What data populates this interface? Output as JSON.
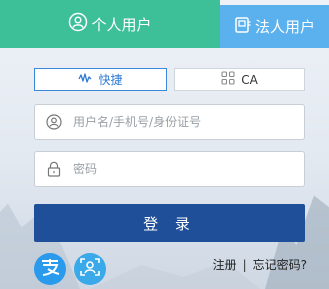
{
  "tabs": {
    "personal_label": "个人用户",
    "legal_label": "法人用户"
  },
  "modes": {
    "quick_label": "快捷",
    "ca_label": "CA"
  },
  "fields": {
    "username_placeholder": "用户名/手机号/身份证号",
    "password_placeholder": "密码"
  },
  "login_label": "登 录",
  "links": {
    "register": "注册",
    "separator": "|",
    "forgot": "忘记密码?"
  },
  "colors": {
    "personal_tab": "#3dbf98",
    "legal_tab": "#5bb0ee",
    "login_button": "#1e4f98",
    "active_mode_border": "#3c89d9"
  },
  "icons": {
    "personal_tab": "person-circle-icon",
    "legal_tab": "document-icon",
    "quick": "quick-wave-icon",
    "ca": "ca-certificate-icon",
    "user_field": "user-icon",
    "password_field": "lock-icon",
    "alipay": "alipay-icon",
    "face_login": "person-scan-icon"
  }
}
